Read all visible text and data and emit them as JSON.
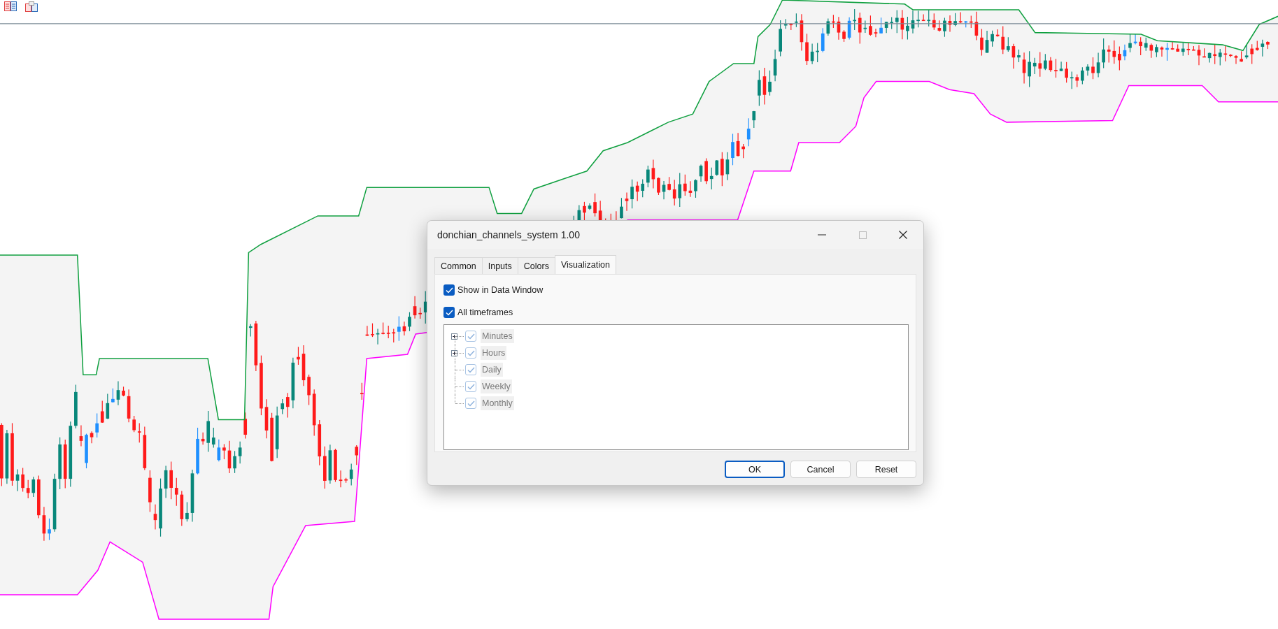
{
  "dialog": {
    "title": "donchian_channels_system 1.00",
    "tabs": [
      {
        "label": "Common",
        "selected": false
      },
      {
        "label": "Inputs",
        "selected": false
      },
      {
        "label": "Colors",
        "selected": false
      },
      {
        "label": "Visualization",
        "selected": true
      }
    ],
    "options": [
      {
        "label": "Show in Data Window",
        "checked": true
      },
      {
        "label": "All timeframes",
        "checked": true
      }
    ],
    "timeframes": [
      {
        "label": "Minutes",
        "checked": true,
        "disabled": true,
        "expandable": true
      },
      {
        "label": "Hours",
        "checked": true,
        "disabled": true,
        "expandable": true
      },
      {
        "label": "Daily",
        "checked": true,
        "disabled": true,
        "expandable": false
      },
      {
        "label": "Weekly",
        "checked": true,
        "disabled": true,
        "expandable": false
      },
      {
        "label": "Monthly",
        "checked": true,
        "disabled": true,
        "expandable": false
      }
    ],
    "buttons": [
      {
        "label": "OK",
        "default": true
      },
      {
        "label": "Cancel",
        "default": false
      },
      {
        "label": "Reset",
        "default": false
      }
    ]
  }
}
